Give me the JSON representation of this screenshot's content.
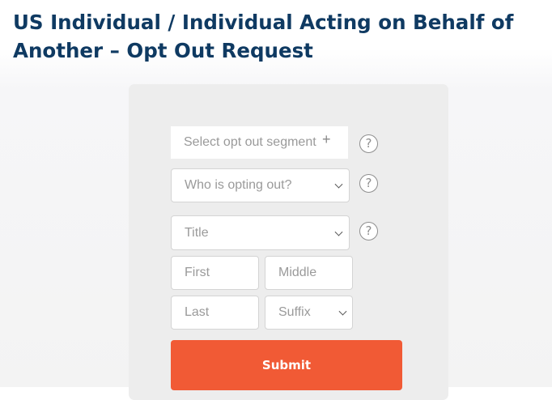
{
  "page": {
    "title": "US Individual / Individual Acting on Behalf of Another – Opt Out Request"
  },
  "form": {
    "segment": {
      "placeholder": "Select opt out segment",
      "add_icon": "plus-icon",
      "add_symbol": "+"
    },
    "who": {
      "placeholder": "Who is opting out?"
    },
    "title": {
      "placeholder": "Title"
    },
    "name": {
      "first_placeholder": "First",
      "middle_placeholder": "Middle",
      "last_placeholder": "Last"
    },
    "suffix": {
      "placeholder": "Suffix"
    },
    "help": {
      "icon": "help-icon",
      "symbol": "?"
    },
    "submit_label": "Submit"
  },
  "colors": {
    "title": "#0f3a62",
    "card_background": "#ededed",
    "submit_background": "#f15a35",
    "submit_text": "#ffffff",
    "placeholder_text": "#9a9a9a"
  }
}
